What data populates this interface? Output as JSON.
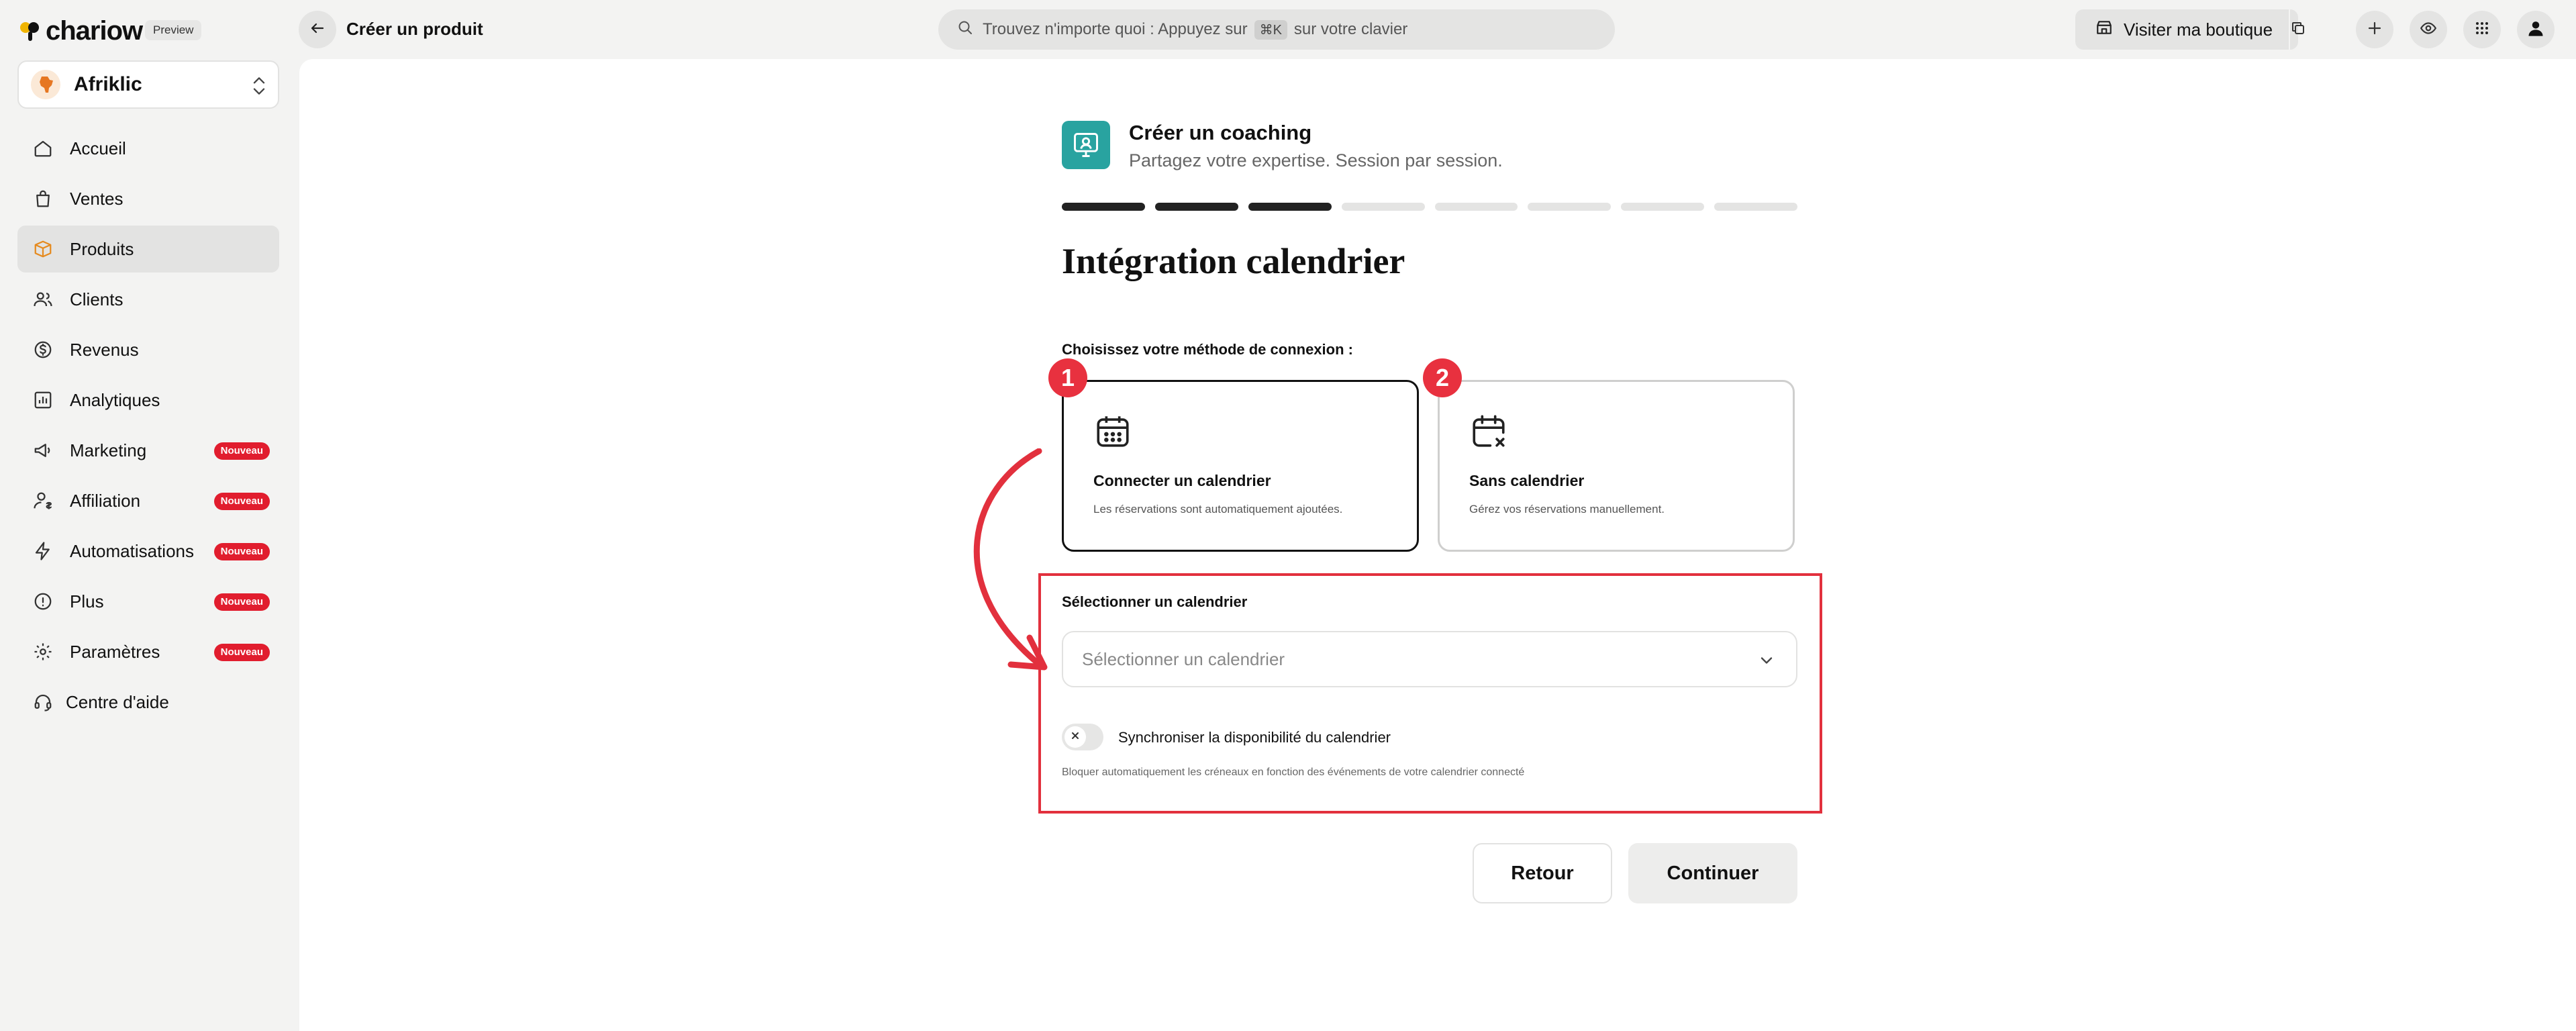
{
  "app": {
    "brand": "chariow",
    "preview_badge": "Preview",
    "page_title": "Créer un produit"
  },
  "search": {
    "prefix": "Trouvez n'importe quoi : Appuyez sur",
    "shortcut": "⌘K",
    "suffix": "sur votre clavier"
  },
  "topbar": {
    "visit_label": "Visiter ma boutique",
    "icons": [
      "back-arrow-icon",
      "search-icon",
      "storefront-icon",
      "copy-icon",
      "plus-icon",
      "eye-icon",
      "apps-grid-icon",
      "user-avatar-icon"
    ]
  },
  "shop": {
    "name": "Afriklic",
    "avatar_caption": "Afriklic"
  },
  "sidebar": {
    "items": [
      {
        "label": "Accueil",
        "icon": "home-icon",
        "active": false
      },
      {
        "label": "Ventes",
        "icon": "shopping-bag-icon",
        "active": false
      },
      {
        "label": "Produits",
        "icon": "box-icon",
        "active": true
      },
      {
        "label": "Clients",
        "icon": "users-icon",
        "active": false
      },
      {
        "label": "Revenus",
        "icon": "dollar-circle-icon",
        "active": false
      },
      {
        "label": "Analytiques",
        "icon": "chart-icon",
        "active": false
      },
      {
        "label": "Marketing",
        "icon": "megaphone-icon",
        "active": false,
        "badge": "Nouveau"
      },
      {
        "label": "Affiliation",
        "icon": "affiliate-user-icon",
        "active": false,
        "badge": "Nouveau"
      },
      {
        "label": "Automatisations",
        "icon": "lightning-icon",
        "active": false,
        "badge": "Nouveau"
      },
      {
        "label": "Plus",
        "icon": "info-icon",
        "active": false,
        "badge": "Nouveau"
      },
      {
        "label": "Paramètres",
        "icon": "gear-icon",
        "active": false,
        "badge": "Nouveau"
      },
      {
        "label": "Centre d'aide",
        "icon": "headset-icon",
        "active": false
      }
    ]
  },
  "wizard": {
    "title": "Créer un coaching",
    "subtitle": "Partagez votre expertise. Session par session.",
    "steps_total": 8,
    "steps_completed": 3,
    "section_title": "Intégration calendrier",
    "method_label": "Choisissez votre méthode de connexion :",
    "options": [
      {
        "marker": "1",
        "title": "Connecter un calendrier",
        "description": "Les réservations sont automatiquement ajoutées.",
        "selected": true
      },
      {
        "marker": "2",
        "title": "Sans calendrier",
        "description": "Gérez vos réservations manuellement.",
        "selected": false
      }
    ],
    "calendar_select": {
      "label": "Sélectionner un calendrier",
      "placeholder": "Sélectionner un calendrier",
      "value": ""
    },
    "sync": {
      "label": "Synchroniser la disponibilité du calendrier",
      "help": "Bloquer automatiquement les créneaux en fonction des événements de votre calendrier connecté",
      "enabled": false
    },
    "buttons": {
      "back": "Retour",
      "next": "Continuer"
    }
  },
  "colors": {
    "accent_teal": "#29a3a0",
    "annotation_red": "#e2303d",
    "badge_red": "#e11d2e",
    "progress_done": "#222222",
    "progress_todo": "#e4e4e3"
  }
}
